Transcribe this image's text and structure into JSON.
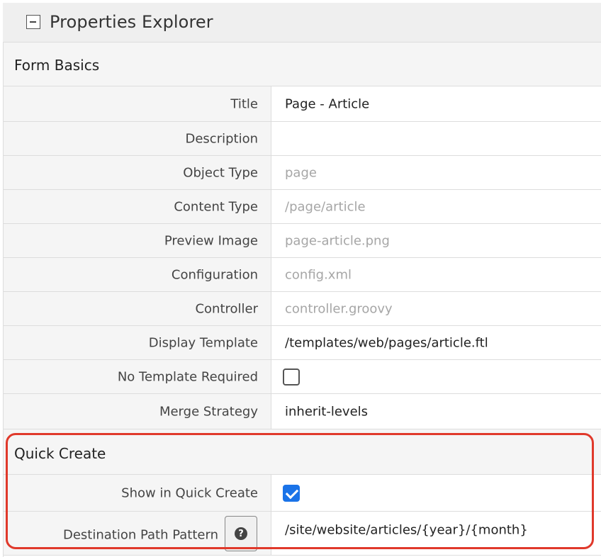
{
  "panel": {
    "title": "Properties Explorer",
    "collapse_icon": "minus-square-icon"
  },
  "sections": {
    "form_basics": {
      "title": "Form Basics",
      "fields": {
        "title": {
          "label": "Title",
          "value": "Page - Article"
        },
        "description": {
          "label": "Description",
          "value": ""
        },
        "object_type": {
          "label": "Object Type",
          "value": "page"
        },
        "content_type": {
          "label": "Content Type",
          "value": "/page/article"
        },
        "preview_image": {
          "label": "Preview Image",
          "value": "page-article.png"
        },
        "configuration": {
          "label": "Configuration",
          "value": "config.xml"
        },
        "controller": {
          "label": "Controller",
          "value": "controller.groovy"
        },
        "display_template": {
          "label": "Display Template",
          "value": "/templates/web/pages/article.ftl"
        },
        "no_template_required": {
          "label": "No Template Required",
          "checked": false
        },
        "merge_strategy": {
          "label": "Merge Strategy",
          "value": "inherit-levels"
        }
      }
    },
    "quick_create": {
      "title": "Quick Create",
      "fields": {
        "show_in_quick_create": {
          "label": "Show in Quick Create",
          "checked": true
        },
        "destination_path_pattern": {
          "label": "Destination Path Pattern",
          "value": "/site/website/articles/{year}/{month}",
          "help_icon": "question-circle-icon"
        }
      }
    }
  },
  "colors": {
    "highlight": "#e0392b",
    "checkbox_checked": "#1a73e8",
    "muted_text": "#a6a6a6"
  }
}
